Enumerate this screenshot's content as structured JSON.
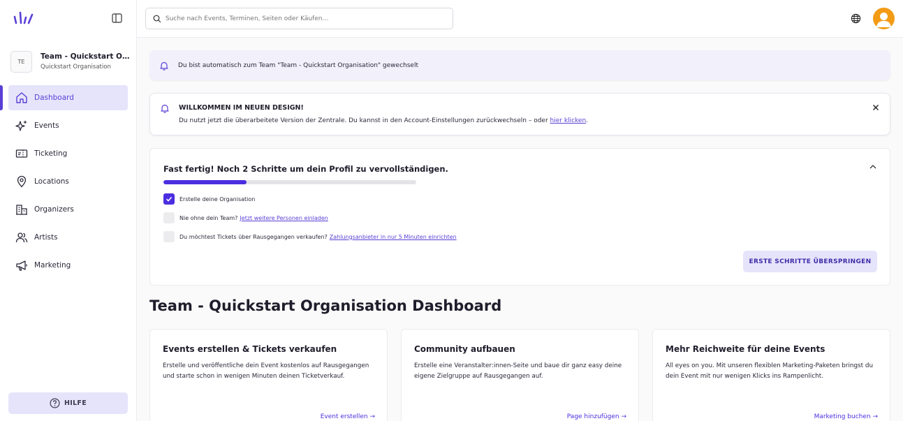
{
  "sidebar": {
    "team": {
      "avatar": "TE",
      "name": "Team - Quickstart Orga…",
      "subtitle": "Quickstart Organisation"
    },
    "items": [
      {
        "label": "Dashboard",
        "icon": "home-icon",
        "active": true
      },
      {
        "label": "Events",
        "icon": "sparkles-icon"
      },
      {
        "label": "Ticketing",
        "icon": "ticket-icon"
      },
      {
        "label": "Locations",
        "icon": "map-pin-icon"
      },
      {
        "label": "Organizers",
        "icon": "buildings-icon"
      },
      {
        "label": "Artists",
        "icon": "users-icon"
      },
      {
        "label": "Marketing",
        "icon": "megaphone-icon"
      }
    ],
    "help_label": "HILFE"
  },
  "topbar": {
    "search_placeholder": "Suche nach Events, Terminen, Seiten oder Käufen…"
  },
  "notice": {
    "text": "Du bist automatisch zum Team \"Team - Quickstart Organisation\" gewechselt"
  },
  "welcome": {
    "title": "WILLKOMMEN IM NEUEN DESIGN!",
    "text": "Du nutzt jetzt die überarbeitete Version der Zentrale. Du kannst in den Account-Einstellungen zurückwechseln – oder",
    "link": "hier klicken",
    "suffix": "."
  },
  "progress": {
    "title": "Fast fertig! Noch 2 Schritte um dein Profil zu vervollständigen.",
    "completed_fraction": 0.33,
    "steps": [
      {
        "text": "Erstelle deine Organisation",
        "link": "",
        "checked": true
      },
      {
        "text": "Nie ohne dein Team?",
        "link": "Jetzt weitere Personen einladen",
        "checked": false
      },
      {
        "text": "Du möchtest Tickets über Rausgegangen verkaufen?",
        "link": "Zahlungsanbieter in nur 5 Minuten einrichten",
        "checked": false
      }
    ],
    "skip_label": "ERSTE SCHRITTE ÜBERSPRINGEN"
  },
  "dashboard": {
    "title": "Team - Quickstart Organisation Dashboard",
    "cards": [
      {
        "title": "Events erstellen & Tickets verkaufen",
        "text": "Erstelle und veröffentliche dein Event kostenlos auf Rausgegangen und starte schon in wenigen Minuten deinen Ticketverkauf.",
        "link": "Event erstellen →"
      },
      {
        "title": "Community aufbauen",
        "text": "Erstelle eine Veranstalter:innen-Seite und baue dir ganz easy deine eigene Zielgruppe auf Rausgegangen auf.",
        "link": "Page hinzufügen →"
      },
      {
        "title": "Mehr Reichweite für deine Events",
        "text": "All eyes on you. Mit unseren flexiblen Marketing-Paketen bringst du dein Event mit nur wenigen Klicks ins Rampenlicht.",
        "link": "Marketing buchen →"
      }
    ]
  },
  "colors": {
    "accent": "#4b2ee0",
    "accent_light": "#e6e4fb",
    "avatar_orange": "#f39b15"
  }
}
